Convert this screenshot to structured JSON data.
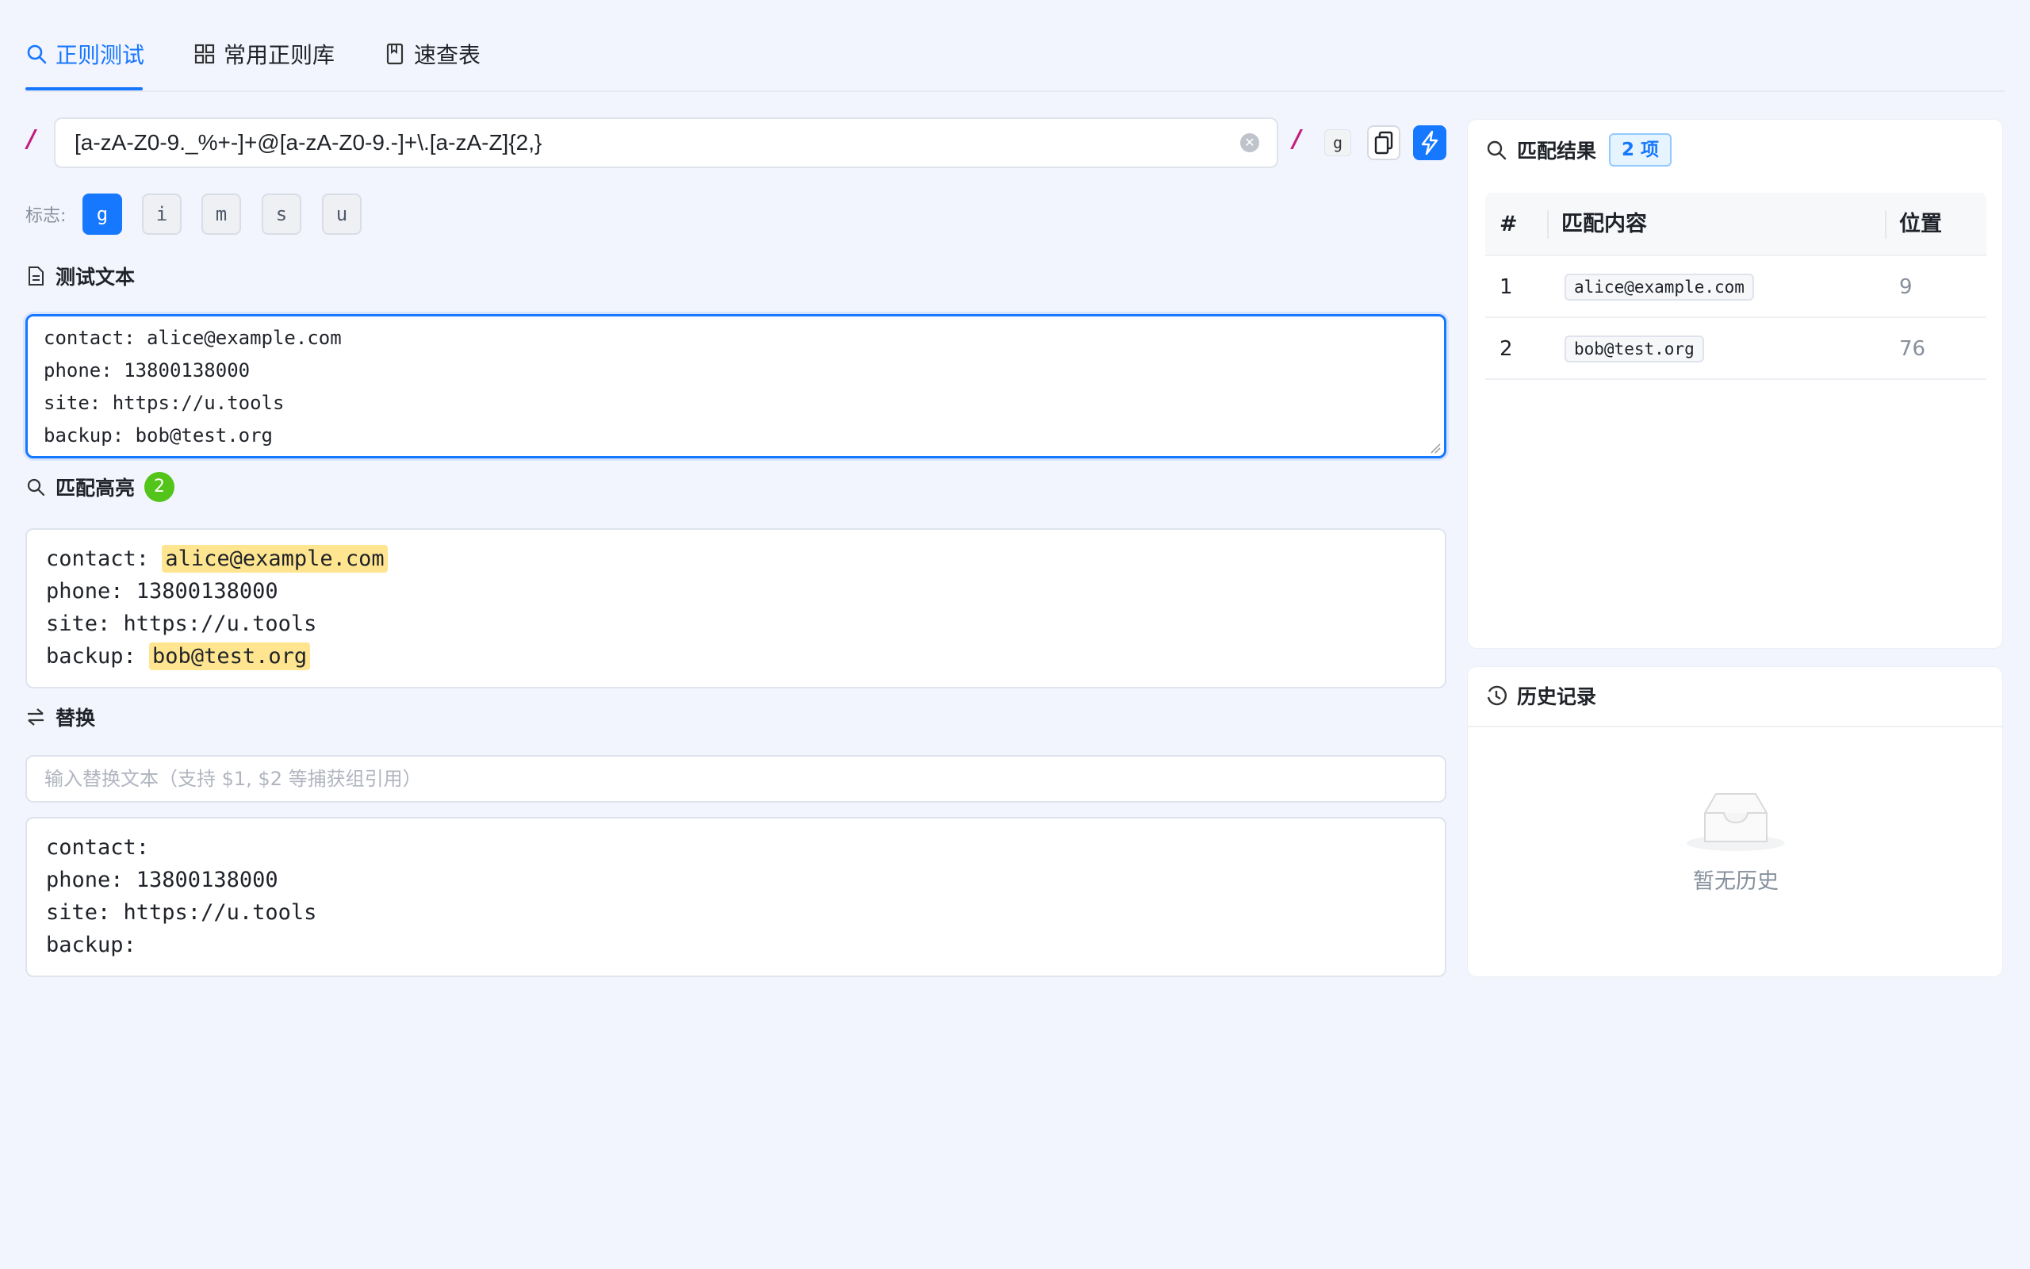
{
  "tabs": [
    {
      "label": "正则测试",
      "icon": "search-icon",
      "active": true
    },
    {
      "label": "常用正则库",
      "icon": "grid-icon",
      "active": false
    },
    {
      "label": "速查表",
      "icon": "book-icon",
      "active": false
    }
  ],
  "regex": {
    "open_slash": "/",
    "close_slash": "/",
    "pattern": "[a-zA-Z0-9._%+-]+@[a-zA-Z0-9.-]+\\.[a-zA-Z]{2,}",
    "active_flags": "g"
  },
  "flags": {
    "label": "标志:",
    "items": [
      {
        "label": "g",
        "on": true
      },
      {
        "label": "i",
        "on": false
      },
      {
        "label": "m",
        "on": false
      },
      {
        "label": "s",
        "on": false
      },
      {
        "label": "u",
        "on": false
      }
    ]
  },
  "test_text": {
    "title": "测试文本",
    "lines": [
      "contact: alice@example.com",
      "phone: 13800138000",
      "site: https://u.tools",
      "backup: bob@test.org"
    ]
  },
  "highlight": {
    "title": "匹配高亮",
    "count": "2",
    "lines": [
      {
        "prefix": "contact: ",
        "match": "alice@example.com"
      },
      {
        "prefix": "phone: 13800138000",
        "match": ""
      },
      {
        "prefix": "site: https://u.tools",
        "match": ""
      },
      {
        "prefix": "backup: ",
        "match": "bob@test.org"
      }
    ]
  },
  "replace": {
    "title": "替换",
    "value": "",
    "placeholder": "输入替换文本（支持 $1, $2 等捕获组引用）",
    "result_lines": [
      "contact:",
      "phone: 13800138000",
      "site: https://u.tools",
      "backup:"
    ]
  },
  "results": {
    "title": "匹配结果",
    "count_tag": "2 项",
    "columns": [
      "#",
      "匹配内容",
      "位置"
    ],
    "rows": [
      {
        "index": "1",
        "match": "alice@example.com",
        "position": "9"
      },
      {
        "index": "2",
        "match": "bob@test.org",
        "position": "76"
      }
    ]
  },
  "history": {
    "title": "历史记录",
    "empty_text": "暂无历史"
  },
  "colors": {
    "accent": "#1677ff",
    "highlight": "#ffe58f",
    "success_badge": "#52c41a",
    "slash": "#c41d7f"
  }
}
